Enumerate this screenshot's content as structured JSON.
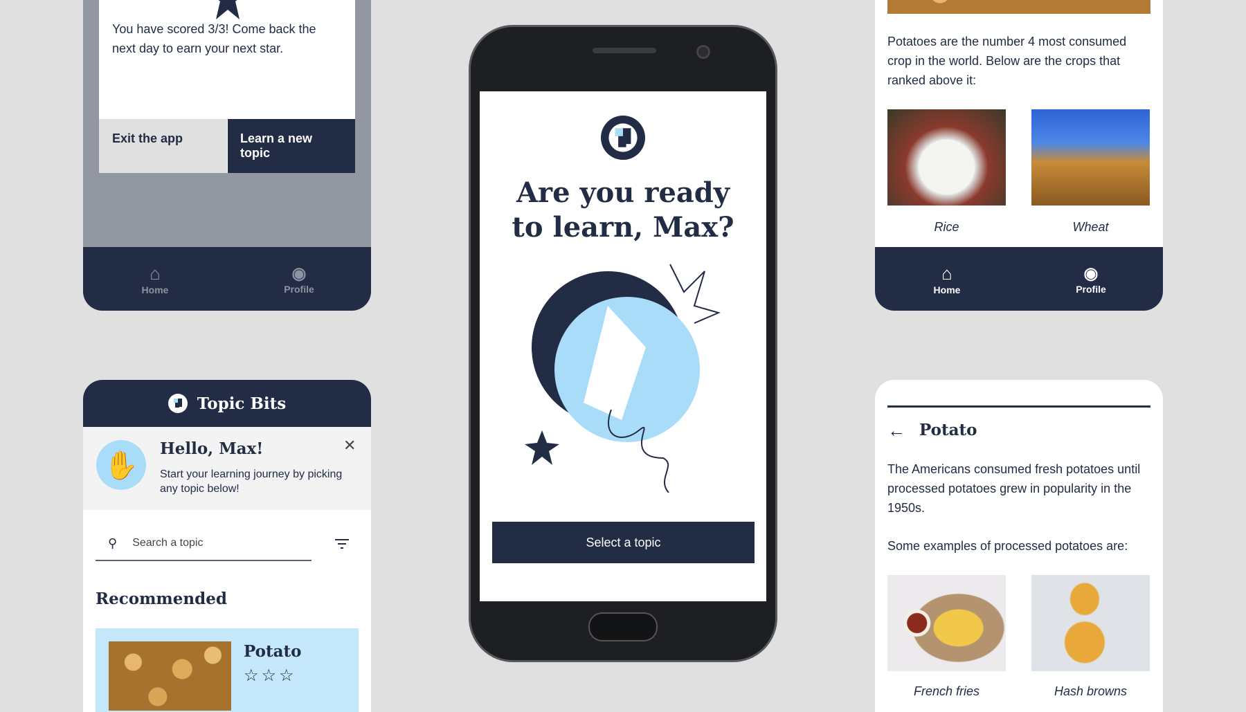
{
  "score_dialog": {
    "message": "You have scored 3/3! Come back the next day to earn your next star.",
    "exit_label": "Exit the app",
    "learn_label": "Learn a new topic"
  },
  "nav": {
    "home": "Home",
    "profile": "Profile"
  },
  "home_screen": {
    "app_title": "Topic Bits",
    "greeting_title": "Hello, Max!",
    "greeting_text": "Start your learning journey by picking any topic below!",
    "search_placeholder": "Search a topic",
    "section_title": "Recommended",
    "recommended": [
      {
        "title": "Potato",
        "stars_earned": 0,
        "stars_total": 3
      }
    ]
  },
  "phone": {
    "heading": "Are you ready to learn, Max?",
    "button": "Select a topic"
  },
  "crops_screen": {
    "text": "Potatoes are the number 4 most consumed crop in the world. Below are the crops that ranked above it:",
    "items": [
      {
        "caption": "Rice"
      },
      {
        "caption": "Wheat"
      }
    ]
  },
  "potato_screen": {
    "title": "Potato",
    "para1": "The Americans consumed fresh potatoes until processed potatoes grew in popularity in the 1950s.",
    "para2": "Some examples of processed potatoes are:",
    "items": [
      {
        "caption": "French fries"
      },
      {
        "caption": "Hash browns"
      }
    ]
  },
  "colors": {
    "navy": "#222c44",
    "light_blue": "#a8dcf9",
    "card_blue": "#c5e7fb",
    "overlay": "#9397a2",
    "background": "#e0e0e0"
  }
}
